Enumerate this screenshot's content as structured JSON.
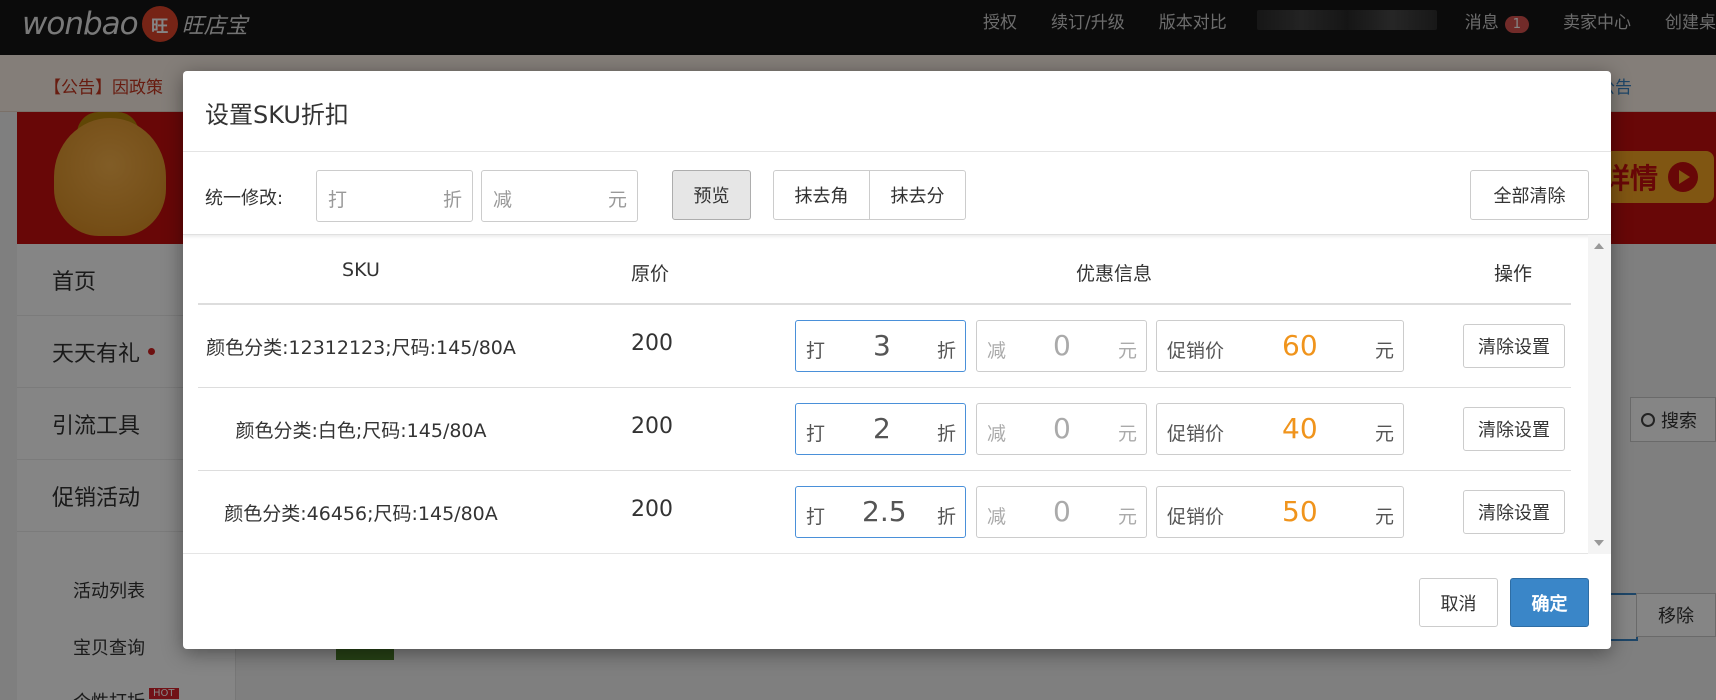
{
  "topbar": {
    "logo_word": "wonbao",
    "logo_badge": "旺",
    "logo_cn": "旺店宝",
    "nav": [
      "授权",
      "续订/升级",
      "版本对比"
    ],
    "messages_label": "消息",
    "messages_count": "1",
    "seller_center": "卖家中心",
    "create_desk": "创建桌"
  },
  "notice": {
    "text": "【公告】因政策",
    "right_link": "公告"
  },
  "banner": {
    "button_label": "详情"
  },
  "sidebar": {
    "items": [
      "首页",
      "天天有礼",
      "引流工具",
      "促销活动"
    ],
    "sub_items": [
      "活动列表",
      "宝贝查询",
      "个性打折"
    ],
    "hot_badge": "HOT"
  },
  "background_controls": {
    "search_label": "搜索",
    "remove_label": "移除"
  },
  "dialog": {
    "title": "设置SKU折扣",
    "bulk_label": "统一修改:",
    "discount_prefix": "打",
    "discount_suffix": "折",
    "reduce_prefix": "减",
    "reduce_suffix": "元",
    "preview_label": "预览",
    "round_jiao_label": "抹去角",
    "round_fen_label": "抹去分",
    "clear_all_label": "全部清除",
    "columns": [
      "SKU",
      "原价",
      "优惠信息",
      "操作"
    ],
    "promo_prefix": "促销价",
    "promo_suffix": "元",
    "clear_row_label": "清除设置",
    "rows": [
      {
        "sku": "颜色分类:12312123;尺码:145/80A",
        "price": "200",
        "discount": "3",
        "reduce": "0",
        "promo": "60"
      },
      {
        "sku": "颜色分类:白色;尺码:145/80A",
        "price": "200",
        "discount": "2",
        "reduce": "0",
        "promo": "40"
      },
      {
        "sku": "颜色分类:46456;尺码:145/80A",
        "price": "200",
        "discount": "2.5",
        "reduce": "0",
        "promo": "50"
      }
    ],
    "cancel_label": "取消",
    "confirm_label": "确定"
  }
}
